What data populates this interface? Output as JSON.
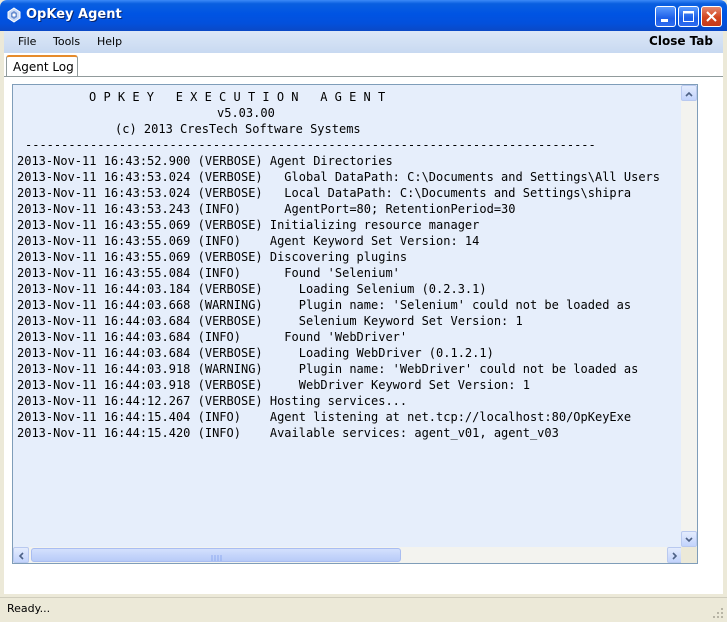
{
  "window": {
    "title": "OpKey Agent",
    "minimize_icon": "minimize-icon",
    "maximize_icon": "maximize-icon",
    "close_icon": "close-icon"
  },
  "menu": {
    "items": [
      {
        "label": "File"
      },
      {
        "label": "Tools"
      },
      {
        "label": "Help"
      }
    ],
    "close_tab_label": "Close Tab"
  },
  "tabs": [
    {
      "label": "Agent Log",
      "active": true
    }
  ],
  "log": {
    "header_title": "O P K E Y   E X E C U T I O N   A G E N T",
    "header_version": "v5.03.00",
    "header_copyright": "(c) 2013 CresTech Software Systems",
    "separator": "-------------------------------------------------------------------------------",
    "lines": [
      "2013-Nov-11 16:43:52.900 (VERBOSE) Agent Directories",
      "2013-Nov-11 16:43:53.024 (VERBOSE)   Global DataPath: C:\\Documents and Settings\\All Users",
      "2013-Nov-11 16:43:53.024 (VERBOSE)   Local DataPath: C:\\Documents and Settings\\shipra",
      "2013-Nov-11 16:43:53.243 (INFO)      AgentPort=80; RetentionPeriod=30",
      "2013-Nov-11 16:43:55.069 (VERBOSE) Initializing resource manager",
      "2013-Nov-11 16:43:55.069 (INFO)    Agent Keyword Set Version: 14",
      "2013-Nov-11 16:43:55.069 (VERBOSE) Discovering plugins",
      "2013-Nov-11 16:43:55.084 (INFO)      Found 'Selenium'",
      "2013-Nov-11 16:44:03.184 (VERBOSE)     Loading Selenium (0.2.3.1)",
      "2013-Nov-11 16:44:03.668 (WARNING)     Plugin name: 'Selenium' could not be loaded as",
      "2013-Nov-11 16:44:03.684 (VERBOSE)     Selenium Keyword Set Version: 1",
      "2013-Nov-11 16:44:03.684 (INFO)      Found 'WebDriver'",
      "2013-Nov-11 16:44:03.684 (VERBOSE)     Loading WebDriver (0.1.2.1)",
      "2013-Nov-11 16:44:03.918 (WARNING)     Plugin name: 'WebDriver' could not be loaded as",
      "2013-Nov-11 16:44:03.918 (VERBOSE)     WebDriver Keyword Set Version: 1",
      "2013-Nov-11 16:44:12.267 (VERBOSE) Hosting services...",
      "2013-Nov-11 16:44:15.404 (INFO)    Agent listening at net.tcp://localhost:80/OpKeyExe",
      "2013-Nov-11 16:44:15.420 (INFO)    Available services: agent_v01, agent_v03"
    ]
  },
  "scrollbars": {
    "up_icon": "scroll-up-icon",
    "down_icon": "scroll-down-icon",
    "left_icon": "scroll-left-icon",
    "right_icon": "scroll-right-icon"
  },
  "status": {
    "text": "Ready..."
  },
  "colors": {
    "titlebar": "#0054e3",
    "log_background": "#e6eefb",
    "tab_accent": "#e68b2c"
  }
}
